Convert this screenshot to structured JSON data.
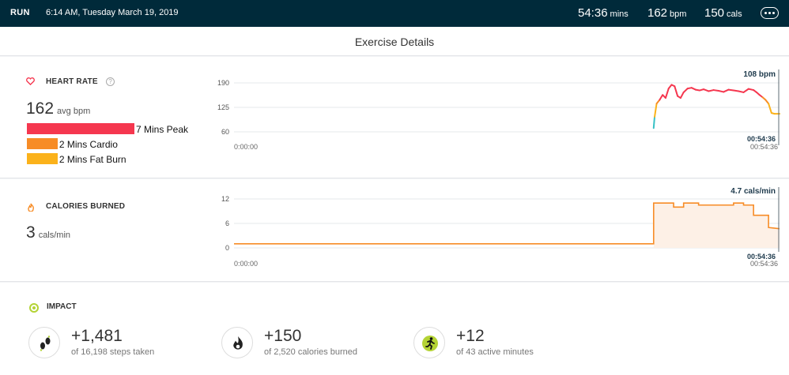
{
  "topbar": {
    "type": "RUN",
    "datetime": "6:14 AM, Tuesday March 19, 2019",
    "duration": {
      "value": "54:36",
      "unit": "mins"
    },
    "heart": {
      "value": "162",
      "unit": "bpm"
    },
    "calories": {
      "value": "150",
      "unit": "cals"
    },
    "more_icon": "more-dots-icon"
  },
  "header": {
    "title": "Exercise Details"
  },
  "heart_rate": {
    "title": "HEART RATE",
    "icon": "heart-icon",
    "help_icon": "help-icon",
    "help_glyph": "?",
    "avg_value": "162",
    "avg_unit": "avg bpm",
    "zones": [
      {
        "label": "7 Mins Peak",
        "minutes": 7,
        "color": "#f5374f"
      },
      {
        "label": "2 Mins Cardio",
        "minutes": 2,
        "color": "#f78c26"
      },
      {
        "label": "2 Mins Fat Burn",
        "minutes": 2,
        "color": "#fbb21b"
      }
    ]
  },
  "calories_burned": {
    "title": "CALORIES BURNED",
    "icon": "flame-icon",
    "avg_value": "3",
    "avg_unit": "cals/min"
  },
  "impact": {
    "title": "IMPACT",
    "icon": "target-icon",
    "metrics": [
      {
        "value": "+1,481",
        "of": "of 16,198 steps taken",
        "icon": "footprints-icon"
      },
      {
        "value": "+150",
        "of": "of 2,520 calories burned",
        "icon": "flame-icon"
      },
      {
        "value": "+12",
        "of": "of 43 active minutes",
        "icon": "running-person-icon"
      }
    ]
  },
  "chart_data": [
    {
      "type": "line",
      "name": "heart-rate",
      "x_start_label": "0:00:00",
      "x_end_label": "00:54:36",
      "cursor_label": "00:54:36",
      "current_label": "108 bpm",
      "x_range": [
        0,
        54.6
      ],
      "y_ticks": [
        60,
        125,
        190
      ],
      "ylim": [
        60,
        190
      ],
      "colors": {
        "peak": "#f5374f",
        "cardio": "#f78c26",
        "fatburn": "#fbb21b",
        "low": "#37c1c5"
      },
      "series": [
        {
          "x": [
            42.0,
            42.1,
            42.3,
            42.6,
            42.9,
            43.2,
            43.5,
            43.8,
            44.1,
            44.4,
            44.7,
            45.0,
            45.4,
            45.8,
            46.2,
            46.6,
            47.0,
            47.5,
            48.0,
            48.5,
            49.0,
            49.5,
            50.0,
            50.5,
            51.0,
            51.5,
            52.0,
            52.3,
            52.6,
            52.9,
            53.2,
            53.5,
            53.8,
            54.1,
            54.6
          ],
          "y": [
            70,
            100,
            135,
            145,
            158,
            150,
            175,
            185,
            181,
            155,
            150,
            165,
            175,
            177,
            172,
            170,
            173,
            168,
            171,
            169,
            166,
            172,
            170,
            168,
            165,
            174,
            171,
            165,
            158,
            152,
            145,
            135,
            110,
            108,
            108
          ]
        }
      ]
    },
    {
      "type": "area",
      "name": "calories",
      "x_start_label": "0:00:00",
      "x_end_label": "00:54:36",
      "cursor_label": "00:54:36",
      "current_label": "4.7 cals/min",
      "x_range": [
        0,
        54.6
      ],
      "y_ticks": [
        0,
        6,
        12
      ],
      "ylim": [
        0,
        12
      ],
      "color": "#f78c26",
      "step": true,
      "series": [
        {
          "x": [
            0,
            42.0,
            42.0,
            44.0,
            44.0,
            45.0,
            45.0,
            46.5,
            46.5,
            49.0,
            49.0,
            50.0,
            50.0,
            51.0,
            51.0,
            52.0,
            52.0,
            53.5,
            53.5,
            54.6
          ],
          "y": [
            1,
            1,
            11,
            11,
            10,
            10,
            11,
            11,
            10.5,
            10.5,
            10.5,
            10.5,
            11,
            11,
            10.5,
            10.5,
            8,
            8,
            5,
            4.7
          ]
        }
      ]
    }
  ]
}
